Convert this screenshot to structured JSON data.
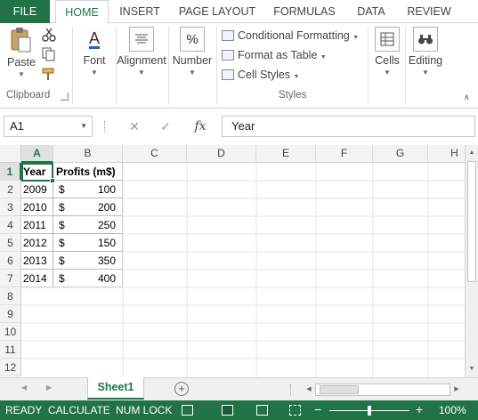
{
  "ribbon_tabs": [
    "FILE",
    "HOME",
    "INSERT",
    "PAGE LAYOUT",
    "FORMULAS",
    "DATA",
    "REVIEW"
  ],
  "ribbon": {
    "paste_label": "Paste",
    "clipboard_label": "Clipboard",
    "font_label": "Font",
    "alignment_label": "Alignment",
    "number_label": "Number",
    "conditional_formatting": "Conditional Formatting",
    "format_as_table": "Format as Table",
    "cell_styles": "Cell Styles",
    "styles_label": "Styles",
    "cells_label": "Cells",
    "editing_label": "Editing",
    "number_icon": "%"
  },
  "formula_bar": {
    "name_box": "A1",
    "cancel_glyph": "✕",
    "enter_glyph": "✓",
    "fx_glyph": "fx",
    "value": "Year"
  },
  "columns": [
    "A",
    "B",
    "C",
    "D",
    "E",
    "F",
    "G",
    "H"
  ],
  "rows": [
    "1",
    "2",
    "3",
    "4",
    "5",
    "6",
    "7",
    "8",
    "9",
    "10",
    "11",
    "12"
  ],
  "table": {
    "header_year": "Year",
    "header_profits": "Profits (m$)",
    "currency_symbol": "$",
    "data": [
      {
        "year": "2009",
        "profit": "100"
      },
      {
        "year": "2010",
        "profit": "200"
      },
      {
        "year": "2011",
        "profit": "250"
      },
      {
        "year": "2012",
        "profit": "150"
      },
      {
        "year": "2013",
        "profit": "350"
      },
      {
        "year": "2014",
        "profit": "400"
      }
    ]
  },
  "sheet_tab": "Sheet1",
  "add_sheet_glyph": "+",
  "status": {
    "ready": "READY",
    "calculate": "CALCULATE",
    "num_lock": "NUM LOCK",
    "zoom_minus": "−",
    "zoom_plus": "+",
    "zoom": "100%",
    "zoom_fraction": 0.5
  },
  "colors": {
    "excel_green": "#217346"
  }
}
